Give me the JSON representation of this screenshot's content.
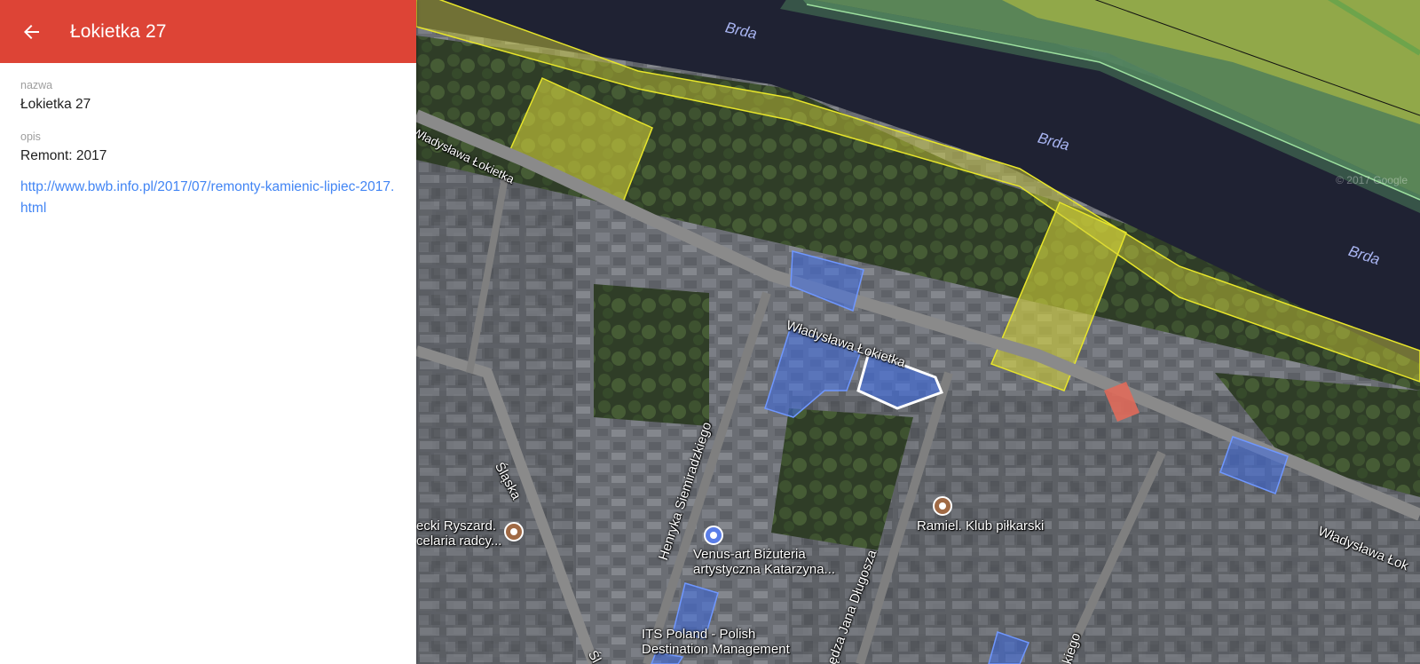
{
  "header": {
    "title": "Łokietka 27",
    "back_icon": "arrow-left-icon",
    "color": "#dd4436"
  },
  "details": {
    "name_label": "nazwa",
    "name_value": "Łokietka 27",
    "desc_label": "opis",
    "desc_value": "Remont: 2017",
    "link": "http://www.bwb.info.pl/2017/07/remonty-kamienic-lipiec-2017.html"
  },
  "map": {
    "rivers": [
      "Brda",
      "Brda",
      "Brda"
    ],
    "streets": {
      "lokietka_top": "Władysława Łokietka",
      "lokietka_mid": "Władysława Łokietka",
      "lokietka_right": "Władysława Łok",
      "semiradzkiego": "Henryka Siemiradzkiego",
      "slaska": "Śląska",
      "slaska_bottom": "Śl",
      "dlugosza": "ędza Jana Długosza",
      "bottom_right": "kiego"
    },
    "pois": {
      "lawyer_line1": "ecki Ryszard.",
      "lawyer_line2": "celaria radcy...",
      "venus_line1": "Venus-art Biżuteria",
      "venus_line2": "artystyczna Katarzyna...",
      "ramiel": "Ramiel. Klub piłkarski",
      "its_line1": "ITS Poland - Polish",
      "its_line2": "Destination Management"
    },
    "copyright": "© 2017 Google",
    "colors": {
      "river": "#1f2233",
      "yellow_overlay": "#d4d23a",
      "blue_overlay": "#3f6ee6",
      "selected_outline": "#ffffff"
    }
  }
}
